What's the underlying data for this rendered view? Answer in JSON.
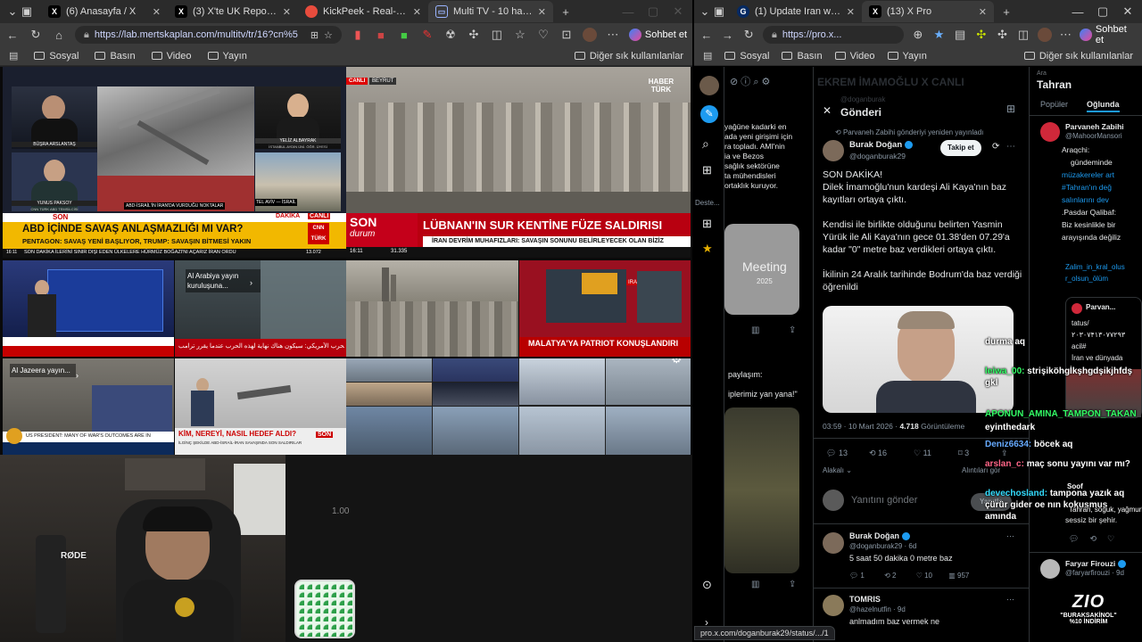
{
  "left_browser": {
    "tabs": [
      {
        "title": "(6) Anasayfa / X",
        "icon": "x-logo-icon"
      },
      {
        "title": "(3) X'te UK Report: \"8KUSU... — A",
        "icon": "x-logo-icon"
      },
      {
        "title": "KickPeek - Real-time URL Cra",
        "icon": "kickpeek-icon"
      },
      {
        "title": "Multi TV - 10 haber kana",
        "icon": "tv-icon"
      }
    ],
    "url": "https://lab.mertskaplan.com/multitv/tr/16?cn%5",
    "copilot_label": "Sohbet et",
    "bookmarks": [
      "Sosyal",
      "Basın",
      "Video",
      "Yayın"
    ],
    "other_bookmarks": "Diğer sık kullanılanlar"
  },
  "tv_wall": {
    "cnn_top": {
      "name1": "BÜŞRA ARSLANTAŞ",
      "name2": "YELİZ ALBAYRAK",
      "name2_sub": "İSTANBUL AYDIN ÜNİ. ÖĞR. ÜYESİ",
      "name3": "YUNUS PAKSOY",
      "name3_sub": "CNN TÜRK ABD TEMSİLCİSİ",
      "caption_mid": "ABD-İSRAİL'İN İRAN'DA VURDUĞU NOKTALAR",
      "caption_city": "TEL AVİV — İSRAİL",
      "badge": "CANLI",
      "son": "SON",
      "dakika": "DAKİKA",
      "headline": "ABD İÇİNDE SAVAŞ ANLAŞMAZLIĞI MI VAR?",
      "subline": "PENTAGON: SAVAŞ YENİ BAŞLIYOR, TRUMP: SAVAŞIN BİTMESİ YAKIN",
      "bottom": "SON DAKİKA   İLERİNİ SINIR DIŞI EDEN ÜLKELERE HÜRMÜZ BOĞAZI'NI AÇARIZ   İRAN ORDU",
      "time": "16:11",
      "count": "13.072",
      "logo": "CNN TÜRK"
    },
    "haberturk": {
      "logo": "HABER TÜRK",
      "badge": "CANLI",
      "badge_city": "BEYRUT",
      "son": "SON",
      "durum": "durum",
      "headline": "LÜBNAN'IN SUR KENTİNE FÜZE SALDIRISI",
      "subline": "İRAN DEVRİM MUHAFIZLARI: SAVAŞIN SONUNU BELİRLEYECEK OLAN BİZİZ",
      "time": "16:11",
      "count": "31.335"
    },
    "row2": {
      "alarabiya_overlay": "Al Arabiya yayın kuruluşuna...",
      "malatya": "MALATYA'YA PATRIOT KONUŞLANDIRI",
      "iran_label": "IRAN",
      "arabic": "وزير الحرب الأمريكي: سيكون هناك نهاية لهذه الحرب عندما يقرر ترامب"
    },
    "row3": {
      "aljazeera_overlay": "Al Jazeera yayın...",
      "aljazeera_ticker": "US PRESIDENT: MANY OF WAR'S OUTCOMES ARE IN",
      "kim": "KİM, NEREYİ, NASIL HEDEF ALDI?",
      "kim_sub": "İLGİNÇ ŞEKİLDE ABD-İSRAİL-İRAN SAVAŞINDA SON SALDIRILAR",
      "son": "SON"
    }
  },
  "webcam": {
    "mic_label": "RØDE",
    "zoom": "1.00"
  },
  "right_browser": {
    "tabs": [
      {
        "title": "(1) Update Iran war live: Tehran v",
        "icon": "guardian-icon"
      },
      {
        "title": "(13) X Pro",
        "icon": "x-logo-icon"
      }
    ],
    "url": "https://pro.x...",
    "copilot_label": "Sohbet et",
    "bookmarks": [
      "Sosyal",
      "Basın",
      "Video",
      "Yayın"
    ],
    "other_bookmarks": "Diğer sık kullanılanlar",
    "status_url": "pro.x.com/doganburak29/status/.../1"
  },
  "xpro": {
    "sidebar_more_label": "Deste...",
    "col1": {
      "header_lines": [
        "yağüne kadarki en",
        "ada yeni girişimi için",
        "ra topladı. AMI'nin",
        "ia ve Bezos",
        "sağlık sektörüne",
        "ta mühendisleri",
        "ortaklık kuruyor."
      ],
      "meeting_text": "Meeting",
      "meeting_year": "2025",
      "paylasim": "paylaşım:",
      "quote": "iplerimiz yan yana!\""
    },
    "col2": {
      "bg_header": "EKREM İMAMOĞLU X CANLI",
      "bg_user": "@doganburak",
      "title": "Gönderi",
      "reposted": "Parvaneh Zabihi gönderiyi yeniden yayınladı",
      "author_name": "Burak Doğan",
      "author_handle": "@doganburak29",
      "follow": "Takip et",
      "paragraphs": [
        "SON DAKİKA!",
        "Dilek İmamoğlu'nun kardeşi Ali Kaya'nın baz kayıtları ortaya çıktı.",
        "Kendisi ile birlikte olduğunu belirten Yasmin Yürük ile Ali Kaya'nın gece 01.38'den 07.29'a kadar \"0\" metre baz verdikleri ortaya çıktı.",
        "İkilinin 24 Aralık tarihinde Bodrum'da baz verdiği öğrenildi"
      ],
      "meta": "03:59 · 10 Mart 2026 · ",
      "views": "4.718",
      "views_label": "Görüntüleme",
      "stats": {
        "replies": "13",
        "reposts": "16",
        "likes": "11",
        "bookmarks": "3"
      },
      "related": "Alakalı",
      "quotes_label": "Alıntıları gör",
      "reply_placeholder": "Yanıtını gönder",
      "reply_btn": "Yanıtla",
      "reply1": {
        "name": "Burak Doğan",
        "handle": "@doganburak29 · 6d",
        "text": "5 saat 50 dakika 0 metre baz",
        "stats": [
          "1",
          "2",
          "10",
          "957"
        ]
      },
      "reply2": {
        "name": "TOMRIS",
        "handle": "@hazelnutfin · 9d",
        "text": "anlmadım baz vermek ne"
      }
    },
    "col3": {
      "label_small": "Ara",
      "title": "Tahran",
      "tab1": "Popüler",
      "tab2": "Oğlunda",
      "user1_name": "Parvaneh Zabihi",
      "user1_handle": "@MahoorMansori",
      "lines": [
        "Araqchi:",
        "gündeminde",
        "müzakereler art",
        "#Tahran'ın değ",
        "salınlarını dev",
        ".Pasdar Qalibaf:",
        "Biz kesinlikle bir",
        "arayışında değiliz"
      ],
      "link": "Zalim_in_kral_olus r_olsun_ölüm",
      "qt_name": "Parvan...",
      "qt_lines": [
        "tatus/",
        "۲۰۳۰۷۴۱۳۰۷۷۲۹۳",
        "acil#",
        "İran ve dünyada"
      ],
      "sessiz": "sessiz bir şehir.",
      "user2_name": "Faryar Firouzi",
      "user2_handle": "@faryarfirouzi · 9d"
    }
  },
  "chat_overlay": [
    {
      "user": "",
      "text": "durma aq",
      "color": "#ffffff"
    },
    {
      "user": "leiwa_00:",
      "text": "strişiköhgİkşhgdşikjhfdş gkl",
      "color": "#33ff66"
    },
    {
      "user": "APONUN_AMINA_TAMPON_TAKAN",
      "text": "eyinthedark",
      "color": "#33ff66"
    },
    {
      "user": "Deniz6634:",
      "text": "böcek aq",
      "color": "#66aaff"
    },
    {
      "user": "arslan_c:",
      "text": "maç sonu yayını var mı?",
      "color": "#ff6688"
    },
    {
      "user": "devechosland:",
      "text": "tampona yazık aq çürür gider oe nın kokusmus amında",
      "color": "#33ddff"
    }
  ],
  "zio": {
    "logo": "ZIO",
    "line1": "\"BURAKSAKİNOL\"",
    "line2": "%10 İNDİRİM",
    "chat_name": "Soof",
    "chat_line": "Tahran, soğuk, yağmurlu"
  }
}
